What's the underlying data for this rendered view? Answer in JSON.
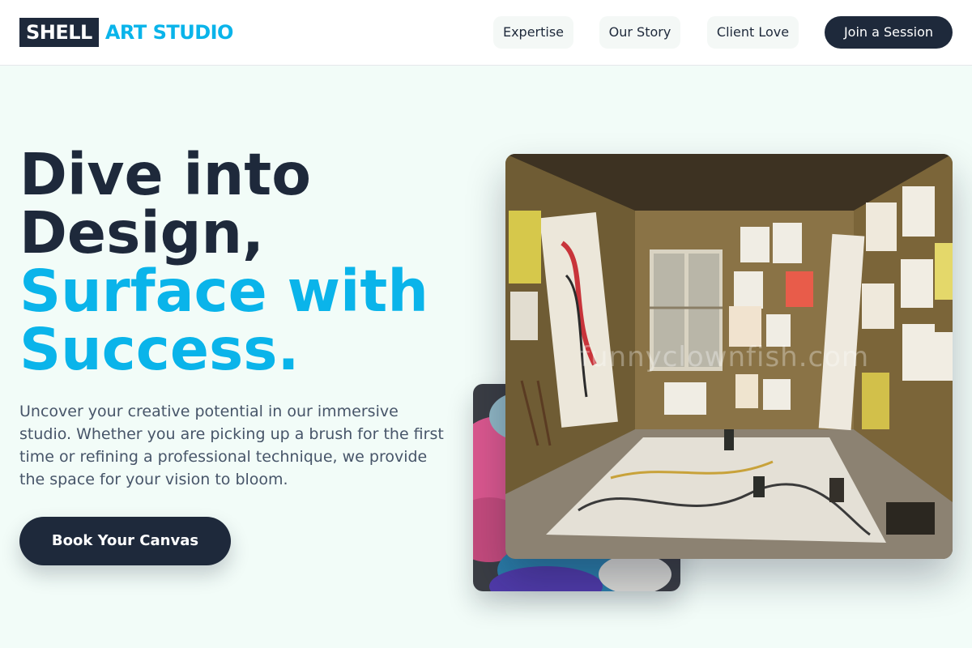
{
  "brand": {
    "mark": "SHELL",
    "name": "ART STUDIO"
  },
  "nav": {
    "links": [
      {
        "label": "Expertise"
      },
      {
        "label": "Our Story"
      },
      {
        "label": "Client Love"
      }
    ],
    "cta": "Join a Session"
  },
  "hero": {
    "headline_dark": [
      "Dive into",
      "Design,"
    ],
    "headline_accent": [
      "Surface with",
      "Success."
    ],
    "lede": "Uncover your creative potential in our immersive studio. Whether you are picking up a brush for the first time or refining a professional technique, we provide the space for your vision to bloom.",
    "cta": "Book Your Canvas",
    "watermark": "funnyclownfish.com"
  },
  "colors": {
    "ink": "#1e293b",
    "accent": "#0ab4ea",
    "background": "#f2fcf8"
  }
}
